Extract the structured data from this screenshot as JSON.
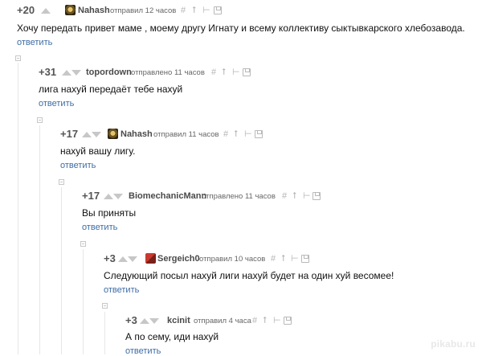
{
  "colors": {
    "link": "#3f6da6",
    "rating": "#555555",
    "author": "#4a4a4a",
    "icon": "#b5b5b5"
  },
  "comments": [
    {
      "rating": "+20",
      "author": "Nahash",
      "action": "отправил 12 часов",
      "avatar": "gold-emblem-avatar",
      "text": "Хочу передать привет маме , моему другу Игнату и всему коллективу сыктывкарского хлебозавода.",
      "reply": "ответить"
    },
    {
      "rating": "+31",
      "author": "topordown",
      "action": "отправлено 11 часов",
      "avatar": "",
      "text": "лига нахуй передаёт тебе нахуй",
      "reply": "ответить"
    },
    {
      "rating": "+17",
      "author": "Nahash",
      "action": "отправил 11 часов",
      "avatar": "gold-emblem-avatar",
      "text": "нахуй вашу лигу.",
      "reply": "ответить"
    },
    {
      "rating": "+17",
      "author": "BiomechanicMann",
      "action": "отправлено 11 часов",
      "avatar": "",
      "text": "Вы приняты",
      "reply": "ответить"
    },
    {
      "rating": "+3",
      "author": "Sergeich0",
      "action": "отправил 10 часов",
      "avatar": "red-avatar",
      "text": "Следующий посыл нахуй лиги нахуй будет на один хуй весомее!",
      "reply": "ответить"
    },
    {
      "rating": "+3",
      "author": "kcinit",
      "action": "отправил 4 часа",
      "avatar": "",
      "text": "А по сему, иди нахуй",
      "reply": "ответить"
    }
  ],
  "icons": {
    "hash": "#",
    "up": "⭡",
    "branch": "⊢"
  },
  "watermark": "pikabu.ru"
}
